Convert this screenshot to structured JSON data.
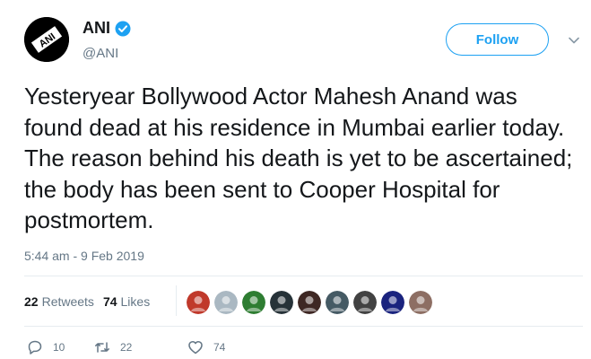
{
  "author": {
    "name": "ANI",
    "handle": "@ANI",
    "logo_text": "ANI",
    "verified": true
  },
  "follow_label": "Follow",
  "tweet": {
    "text": "Yesteryear Bollywood Actor Mahesh Anand was found dead at his residence in Mumbai earlier today. The reason behind his death is yet to be ascertained; the body has been sent to Cooper Hospital for postmortem.",
    "timestamp": "5:44 am - 9 Feb 2019"
  },
  "stats": {
    "retweets_count": "22",
    "retweets_label": "Retweets",
    "likes_count": "74",
    "likes_label": "Likes"
  },
  "liker_avatars": [
    {
      "color": "#c0392b"
    },
    {
      "color": "#aab8c2"
    },
    {
      "color": "#2e7d32"
    },
    {
      "color": "#263238"
    },
    {
      "color": "#3e2723"
    },
    {
      "color": "#455a64"
    },
    {
      "color": "#424242"
    },
    {
      "color": "#1a237e"
    },
    {
      "color": "#8d6e63"
    }
  ],
  "actions": {
    "reply_count": "10",
    "retweet_count": "22",
    "like_count": "74"
  },
  "colors": {
    "accent": "#1da1f2",
    "secondary_text": "#657786",
    "divider": "#e6ecf0"
  }
}
